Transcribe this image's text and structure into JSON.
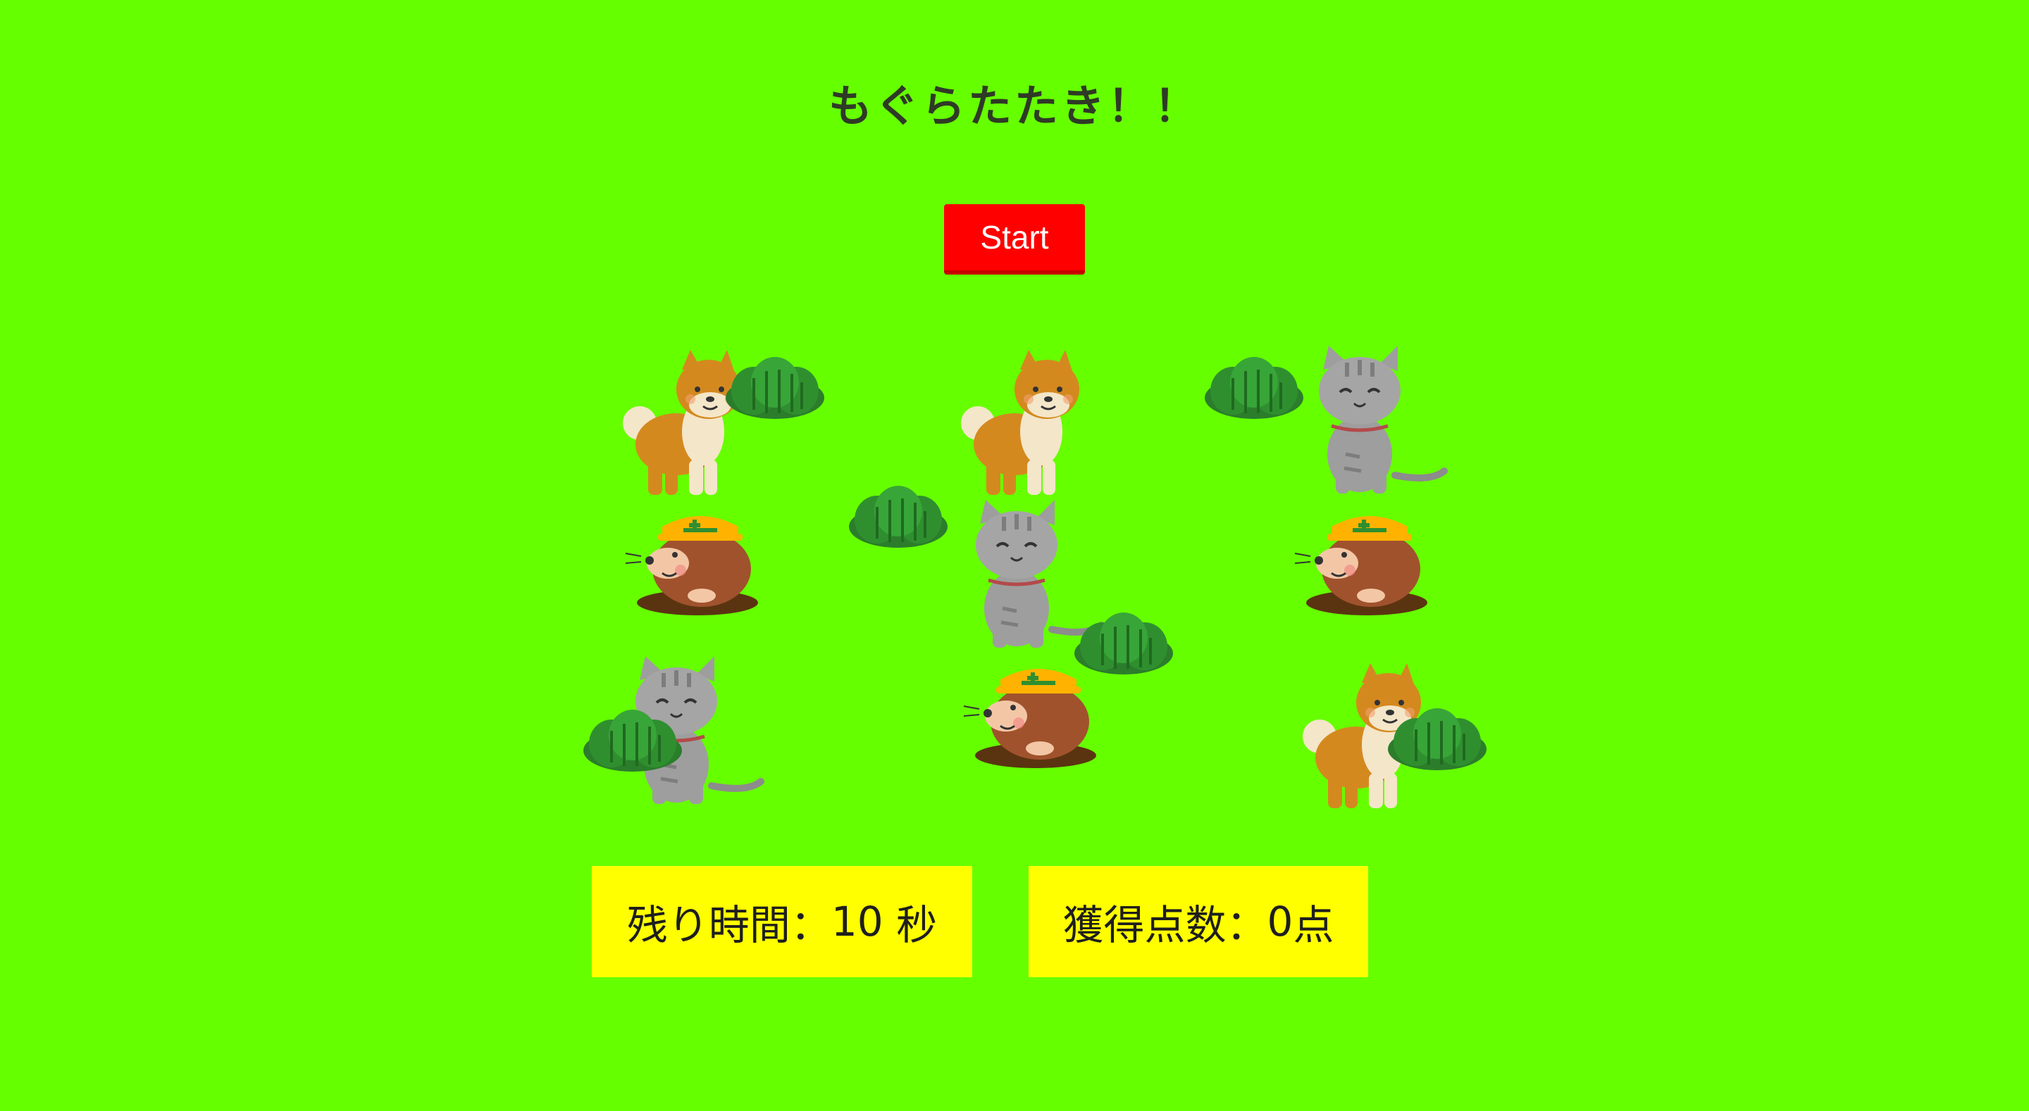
{
  "title": "もぐらたたき！！",
  "start_button": {
    "label": "Start"
  },
  "status": {
    "time_label": "残り時間：",
    "time_value": "10",
    "time_unit": " 秒",
    "score_label": "獲得点数：",
    "score_value": "0",
    "score_unit": "点"
  },
  "board": {
    "holes": [
      {
        "row": 1,
        "col": 1,
        "character": "dog-icon"
      },
      {
        "row": 1,
        "col": 2,
        "character": "dog-icon"
      },
      {
        "row": 1,
        "col": 3,
        "character": "cat-icon"
      },
      {
        "row": 2,
        "col": 1,
        "character": "mole-icon"
      },
      {
        "row": 2,
        "col": 2,
        "character": "cat-icon"
      },
      {
        "row": 2,
        "col": 3,
        "character": "mole-icon"
      },
      {
        "row": 3,
        "col": 1,
        "character": "cat-icon"
      },
      {
        "row": 3,
        "col": 2,
        "character": "mole-icon"
      },
      {
        "row": 3,
        "col": 3,
        "character": "dog-icon"
      }
    ]
  },
  "colors": {
    "background": "#66ff00",
    "start_button": "#ff0000",
    "status_panel": "#ffff00",
    "bush": "#2e8b2e"
  }
}
